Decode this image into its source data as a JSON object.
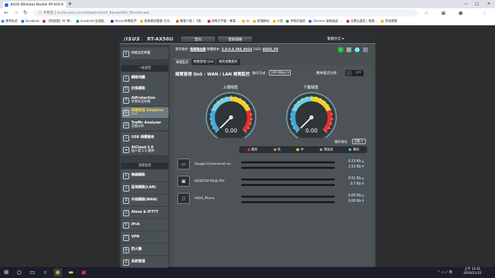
{
  "browser": {
    "tab_title": "ASUS Wireless Router RT-AX5…",
    "omnibox_security": "不安全",
    "omnibox_url": "router.asus.com/AdaptiveQoS_Bandwidth_Monitor.asp",
    "bookmarks": [
      {
        "label": "應用程式",
        "c": "#4285f4"
      },
      {
        "label": "Facebook",
        "c": "#1877f2"
      },
      {
        "label": "【新遊戲】AF 傳...",
        "c": "#d93025"
      },
      {
        "label": "Goodinfo!台灣股...",
        "c": "#0f9d58"
      },
      {
        "label": "Yahoo!奇摩股市",
        "c": "#6001d2"
      },
      {
        "label": "愛華資訊電腦-全付...",
        "c": "#f4b400"
      },
      {
        "label": "專業介紹 | 【我...",
        "c": "#e8710a"
      },
      {
        "label": "地和全字級 - 專業...",
        "c": "#d93025"
      },
      {
        "label": "3c",
        "c": "#f4b400"
      },
      {
        "label": "新聞網站",
        "c": "#f4b400"
      },
      {
        "label": "小說",
        "c": "#f4b400"
      },
      {
        "label": "伊莉討論區",
        "c": "#0f9d58"
      },
      {
        "label": "Chrome 遠端桌面 -...",
        "c": "#1a73e8"
      },
      {
        "label": "化繁志盡堂 | 健康...",
        "c": "#d93025"
      },
      {
        "label": "其他書籤",
        "c": "#f4b400"
      }
    ]
  },
  "router": {
    "brand": "/ISUS",
    "model": "RT-AX56U",
    "logout": "登出",
    "reboot": "重新開機",
    "language": "繁體中文 ▾",
    "info": {
      "mode_label": "運作模式:",
      "mode_value": "無線路由器",
      "fw_label": "韌體版本:",
      "fw_value": "3.0.0.4.384_9424",
      "ssid_label": "SSID:",
      "ssid_value": "ASUS_F0"
    },
    "tabs": [
      "頻寬監控",
      "頻寬管理 QoS",
      "網頁瀏覽歷史"
    ],
    "sidebar": {
      "quick": "網路設定精靈",
      "general_header": "一般設定",
      "general": [
        {
          "t": "網路地圖",
          "s": ""
        },
        {
          "t": "訪客網路",
          "s": ""
        },
        {
          "t": "AiProtection",
          "s": "智慧安全防護"
        },
        {
          "t": "頻寬管理 Adaptive",
          "s": "QoS"
        },
        {
          "t": "Traffic Analyzer",
          "s": "流量分析"
        },
        {
          "t": "USB 相關應用",
          "s": ""
        },
        {
          "t": "AiCloud 2.0",
          "s": "個人雲 2.0 應用"
        }
      ],
      "advanced_header": "進階設定",
      "advanced": [
        "無線網路",
        "區域網路(LAN)",
        "外部網路(WAN)",
        "Alexa & IFTTT",
        "IPv6",
        "VPN",
        "防火牆",
        "系統管理"
      ]
    },
    "panel": {
      "title": "頻寬管理 QoS - WAN / LAN 頻寬監控",
      "display_label": "顯示方式",
      "unit_value": "100 Mbps",
      "app_analysis": "應用程式分析",
      "toggle": "OFF",
      "upload_label": "上傳頻寬",
      "download_label": "下載頻寬",
      "upload_value": "0.00",
      "download_value": "0.00",
      "gauge_level_up": 0,
      "gauge_level_down": 0,
      "sort_label": "顯示排位",
      "sort_value": "自動",
      "legend": [
        {
          "label": "最高",
          "c": "#e8312b"
        },
        {
          "label": "高",
          "c": "#f28a1e"
        },
        {
          "label": "中",
          "c": "#f0d12b"
        },
        {
          "label": "預設值",
          "c": "#9aa1a5"
        },
        {
          "label": "最低",
          "c": "#4fb7e8"
        }
      ],
      "devices": [
        {
          "name": "Google Chromecast se...",
          "icon": "▭",
          "up": "0.23 Kb",
          "down": "1.52 Kb"
        },
        {
          "name": "DESKTOP-PSQL7PV",
          "icon": "▣",
          "up": "0.51 Kb",
          "down": "0.7 Kb"
        },
        {
          "name": "ASUS_Phone",
          "icon": "▯",
          "up": "0.00 Kb",
          "down": "0.00 Kb"
        }
      ]
    }
  },
  "taskbar": {
    "time": "上午 12:41",
    "date": "2020/11/22"
  }
}
